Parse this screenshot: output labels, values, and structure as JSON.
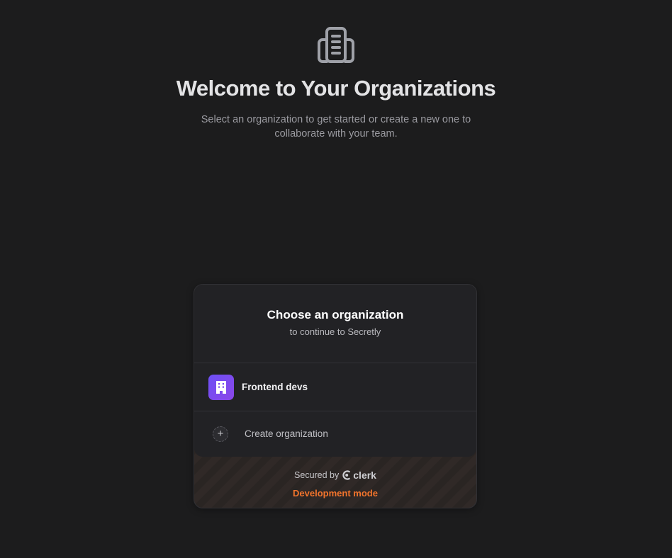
{
  "hero": {
    "icon": "building-icon",
    "title": "Welcome to Your Organizations",
    "subtitle": "Select an organization to get started or create a new one to collaborate with your team."
  },
  "card": {
    "title": "Choose an organization",
    "subtitle": "to continue to Secretly",
    "organizations": [
      {
        "name": "Frontend devs",
        "icon": "building-icon",
        "avatar_color": "#7048f3"
      }
    ],
    "create_label": "Create organization",
    "footer": {
      "secured_by": "Secured by",
      "brand": "clerk",
      "mode": "Development mode"
    }
  },
  "colors": {
    "background": "#1c1c1d",
    "card": "#222225",
    "accent_orange": "#f2742c",
    "avatar_purple": "#7048f3"
  }
}
